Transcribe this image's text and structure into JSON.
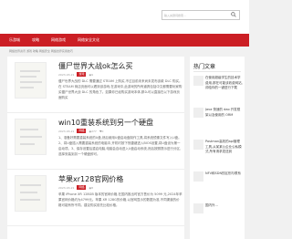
{
  "header": {
    "search_placeholder": "输入关键词搜索..."
  },
  "nav": {
    "items": [
      "乐游城",
      "攻略",
      "网络游戏",
      "网络安全文化"
    ]
  },
  "breadcrumb": "网络世界资讯 游戏 攻略 网络安全 网络世界实用技巧",
  "articles": [
    {
      "title": "僵尸世界大战ok怎么买",
      "date": "2023-03-21",
      "category": "游戏",
      "views": "9",
      "likes": "",
      "excerpt": "僵尸世界大战的 DLC 需要通过 STEAM 上购买,不过目前未来尚未发布该款 DLC 购买。在 STEAM 商店页面可以看到该游戏,在游戏中,此游戏的所有道具包括中文都需要玩家购买僵尸世界大战 DLC 的角色了。如果你已经购买游戏本体,那么可以直接在以下游戏页面购买"
    },
    {
      "title": "win10重装系统到另一个硬盘",
      "date": "2023-03-21",
      "category": "网络",
      "views": "277",
      "likes": "0",
      "excerpt": "1、准备好需要重装系统的U盘,然后使用U盘启动盘制作工具,将系统镜像文件写入U盘。2、将U盘插入需要重装系统的电脑中,开机时按下快捷键进入BIOS设置,将U盘设为第一启动项。3、保存设置后重启电脑,电脑会自动进入U盘启动系统,然后按照提示进行分区,选择安装到另一个硬盘即可。"
    },
    {
      "title": "苹果xr128官网价格",
      "date": "2023-03-21",
      "category": "网络",
      "views": "8",
      "likes": "",
      "excerpt": "苹果 iPhone XR 128GB 版本的官网价格,在国内推出时官方售价为 5099 元,2024年苹果官网价格约为4799元。苹果 XR 128G的价格,以官网显示的数据为准,不同渠道的价格可能有所不同。建议购买前先比较价格。"
    }
  ],
  "sidebar": {
    "title": "热门文章",
    "items": [
      "在使用超级学生的技术学费用,那在可能该收费网站,却给你的一键进行下载",
      "Java 快速的 dao 开发框架以及使用的 ORM",
      "Postman高效的api管理工具,从某某公企业公私模式,所有请求发送到",
      "NFV和SDN的区别与联系",
      "国内外..."
    ]
  }
}
